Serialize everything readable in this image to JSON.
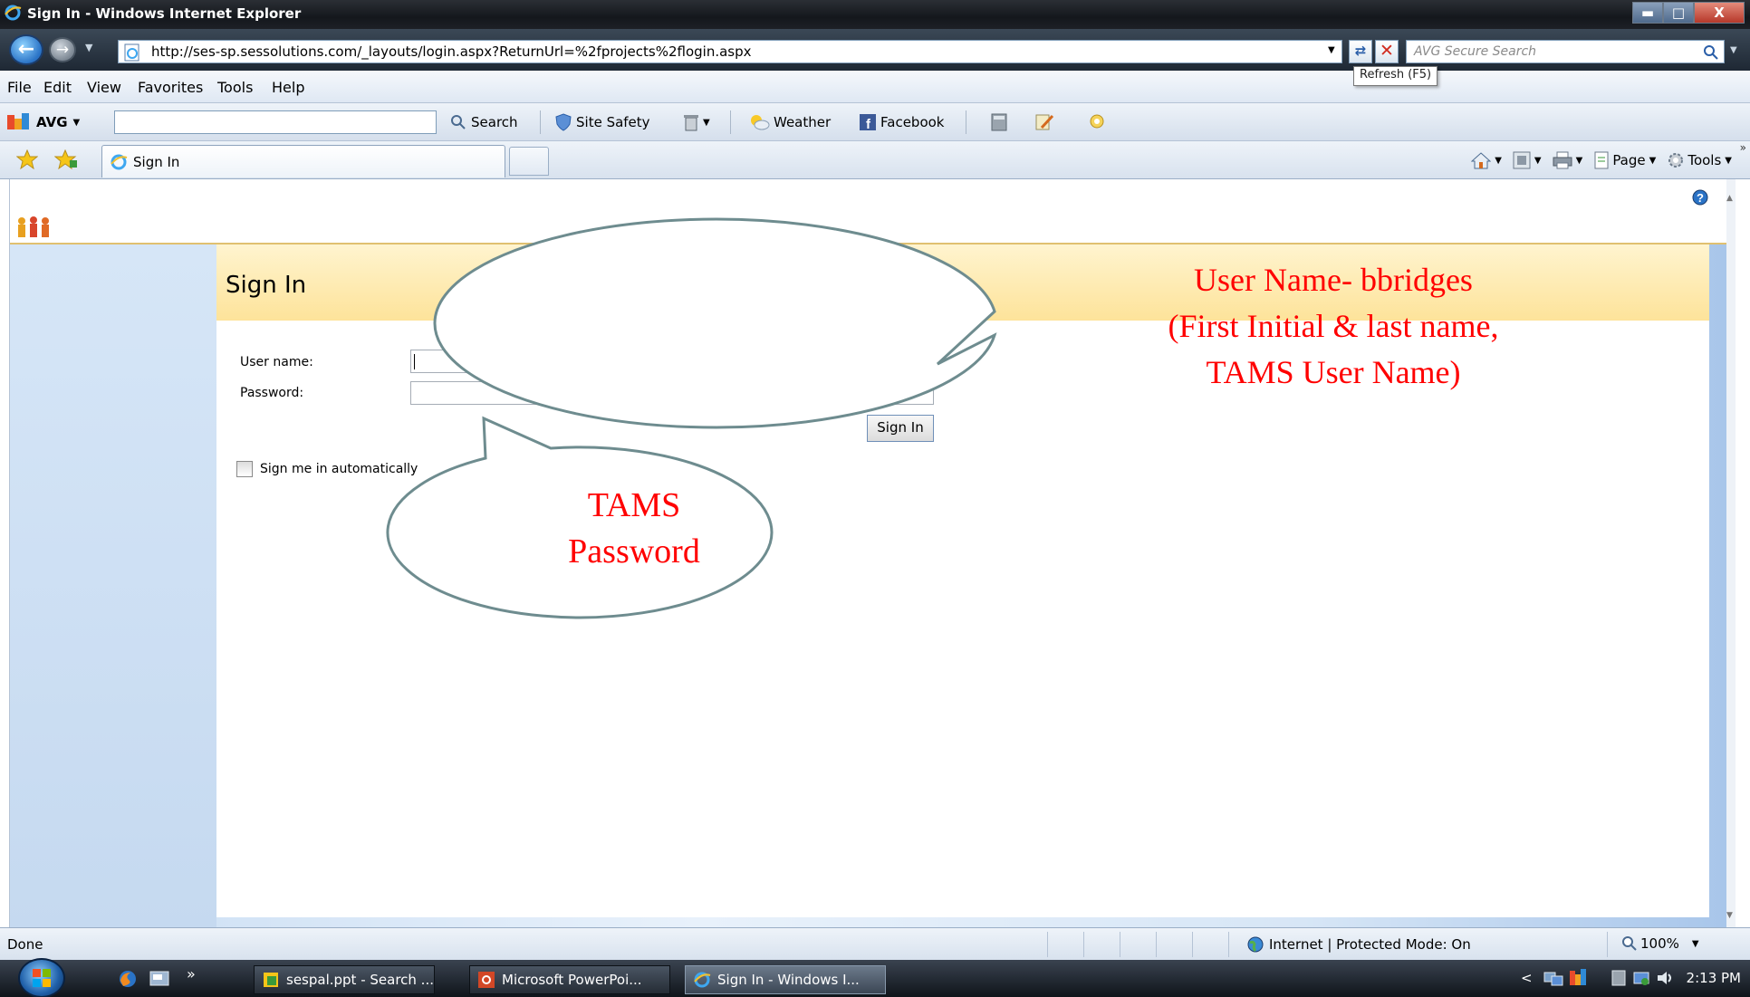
{
  "window": {
    "title": "Sign In - Windows Internet Explorer",
    "min_symbol": "▬",
    "max_symbol": "□",
    "close_symbol": "X"
  },
  "address": {
    "url": "http://ses-sp.sessolutions.com/_layouts/login.aspx?ReturnUrl=%2fprojects%2flogin.aspx",
    "search_placeholder": "AVG Secure Search",
    "refresh_tooltip": "Refresh (F5)"
  },
  "menu": [
    "File",
    "Edit",
    "View",
    "Favorites",
    "Tools",
    "Help"
  ],
  "avg_toolbar": {
    "brand": "AVG",
    "search_label": "Search",
    "site_safety_label": "Site Safety",
    "weather_label": "Weather",
    "facebook_label": "Facebook"
  },
  "tabs": [
    {
      "label": "Sign In",
      "icon": "ie-icon"
    }
  ],
  "command_bar": {
    "page_label": "Page",
    "tools_label": "Tools"
  },
  "page": {
    "heading": "Sign In",
    "username_label": "User name:",
    "username_value": "",
    "password_label": "Password:",
    "password_value": "",
    "signin_button": "Sign In",
    "remember_label": "Sign me in automatically",
    "remember_checked": false
  },
  "callouts": {
    "username": [
      "User Name- bbridges",
      "(First Initial & last name,",
      "TAMS User Name)"
    ],
    "password": [
      "TAMS",
      "Password"
    ]
  },
  "status": {
    "text": "Done",
    "zone": "Internet | Protected Mode: On",
    "zoom": "100%"
  },
  "taskbar": {
    "items": [
      {
        "label": "sespal.ppt - Search ...",
        "icon": "search-app-icon"
      },
      {
        "label": "Microsoft PowerPoi...",
        "icon": "powerpoint-icon"
      },
      {
        "label": "Sign In - Windows I...",
        "icon": "ie-icon",
        "active": true
      }
    ],
    "clock": "2:13 PM"
  },
  "colors": {
    "callout_text": "#ff0000",
    "callout_fill": "#ffffff",
    "callout_stroke": "#6e8c8f",
    "signin_header": "#fde39a"
  }
}
